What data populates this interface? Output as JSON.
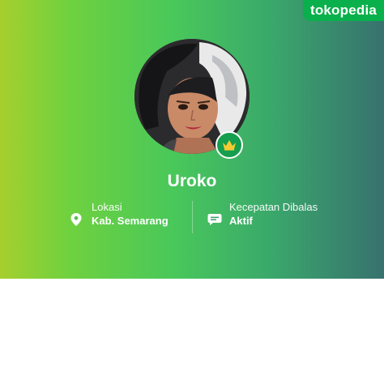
{
  "brand": {
    "logo_text": "tokopedia"
  },
  "shop": {
    "name": "Uroko",
    "badge_icon": "crown-icon",
    "avatar_alt": "shop-avatar"
  },
  "info": {
    "location": {
      "label": "Lokasi",
      "value": "Kab. Semarang",
      "icon": "location-pin-icon"
    },
    "response": {
      "label": "Kecepatan Dibalas",
      "value": "Aktif",
      "icon": "chat-bubble-icon"
    }
  },
  "colors": {
    "brand_green": "#0ab04b",
    "gradient": [
      "#a6cf2e",
      "#6fd13f",
      "#49c85a",
      "#3aa96b",
      "#38716f"
    ]
  }
}
